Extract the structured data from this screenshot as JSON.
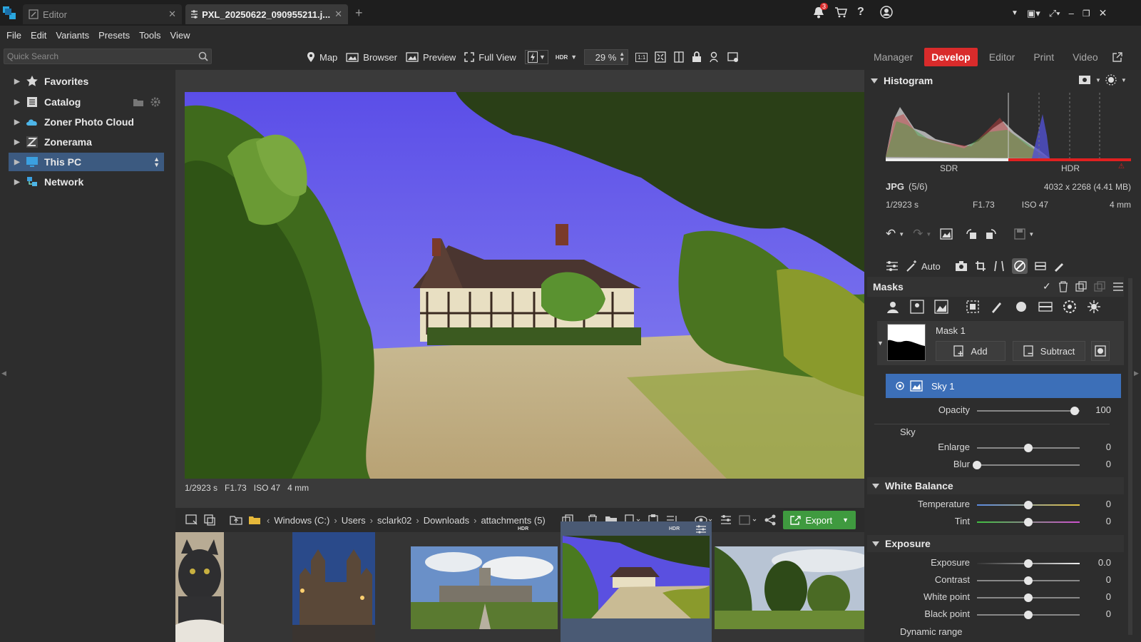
{
  "tabs": [
    {
      "label": "Editor"
    },
    {
      "label": "PXL_20250622_090955211.j..."
    }
  ],
  "topbar": {
    "notif_count": "3"
  },
  "menu": [
    "File",
    "Edit",
    "Variants",
    "Presets",
    "Tools",
    "View"
  ],
  "search": {
    "placeholder": "Quick Search"
  },
  "toolbar": {
    "map": "Map",
    "browser": "Browser",
    "preview": "Preview",
    "fullview": "Full View",
    "hdr": "HDR",
    "zoom": "29 %",
    "onetoone": "1:1"
  },
  "modes": [
    "Manager",
    "Develop",
    "Editor",
    "Print",
    "Video"
  ],
  "nav": [
    {
      "label": "Favorites"
    },
    {
      "label": "Catalog"
    },
    {
      "label": "Zoner Photo Cloud"
    },
    {
      "label": "Zonerama"
    },
    {
      "label": "This PC"
    },
    {
      "label": "Network"
    }
  ],
  "photo_info": {
    "shutter": "1/2923 s",
    "aperture": "F1.73",
    "iso": "ISO 47",
    "focal": "4 mm"
  },
  "path": [
    "Windows (C:)",
    "Users",
    "sclark02",
    "Downloads",
    "attachments (5)"
  ],
  "export_label": "Export",
  "thumb_hdr": "HDR",
  "histogram": {
    "title": "Histogram",
    "sdr": "SDR",
    "hdr": "HDR"
  },
  "file_info": {
    "format": "JPG",
    "index": "(5/6)",
    "dims": "4032 x 2268 (4.41 MB)",
    "shutter": "1/2923 s",
    "aperture": "F1.73",
    "iso": "ISO 47",
    "focal": "4 mm"
  },
  "tools": {
    "auto": "Auto"
  },
  "masks": {
    "title": "Masks",
    "mask_name": "Mask 1",
    "add": "Add",
    "subtract": "Subtract",
    "sub_mask": "Sky 1"
  },
  "mask_sliders": [
    {
      "label": "Opacity",
      "value": "100",
      "level": 0.95
    }
  ],
  "sky": {
    "title": "Sky",
    "sliders": [
      {
        "label": "Enlarge",
        "value": "0",
        "level": 0.5
      },
      {
        "label": "Blur",
        "value": "0",
        "level": 0.0
      }
    ]
  },
  "white_balance": {
    "title": "White Balance",
    "sliders": [
      {
        "label": "Temperature",
        "value": "0",
        "level": 0.5
      },
      {
        "label": "Tint",
        "value": "0",
        "level": 0.5
      }
    ]
  },
  "exposure": {
    "title": "Exposure",
    "sliders": [
      {
        "label": "Exposure",
        "value": "0.0",
        "level": 0.5
      },
      {
        "label": "Contrast",
        "value": "0",
        "level": 0.5
      },
      {
        "label": "White point",
        "value": "0",
        "level": 0.5
      },
      {
        "label": "Black point",
        "value": "0",
        "level": 0.5
      }
    ],
    "dynamic_range": "Dynamic range"
  },
  "colors": {
    "accent": "#d92b2b",
    "selection": "#3c6fb8",
    "export": "#3f9a3f"
  }
}
